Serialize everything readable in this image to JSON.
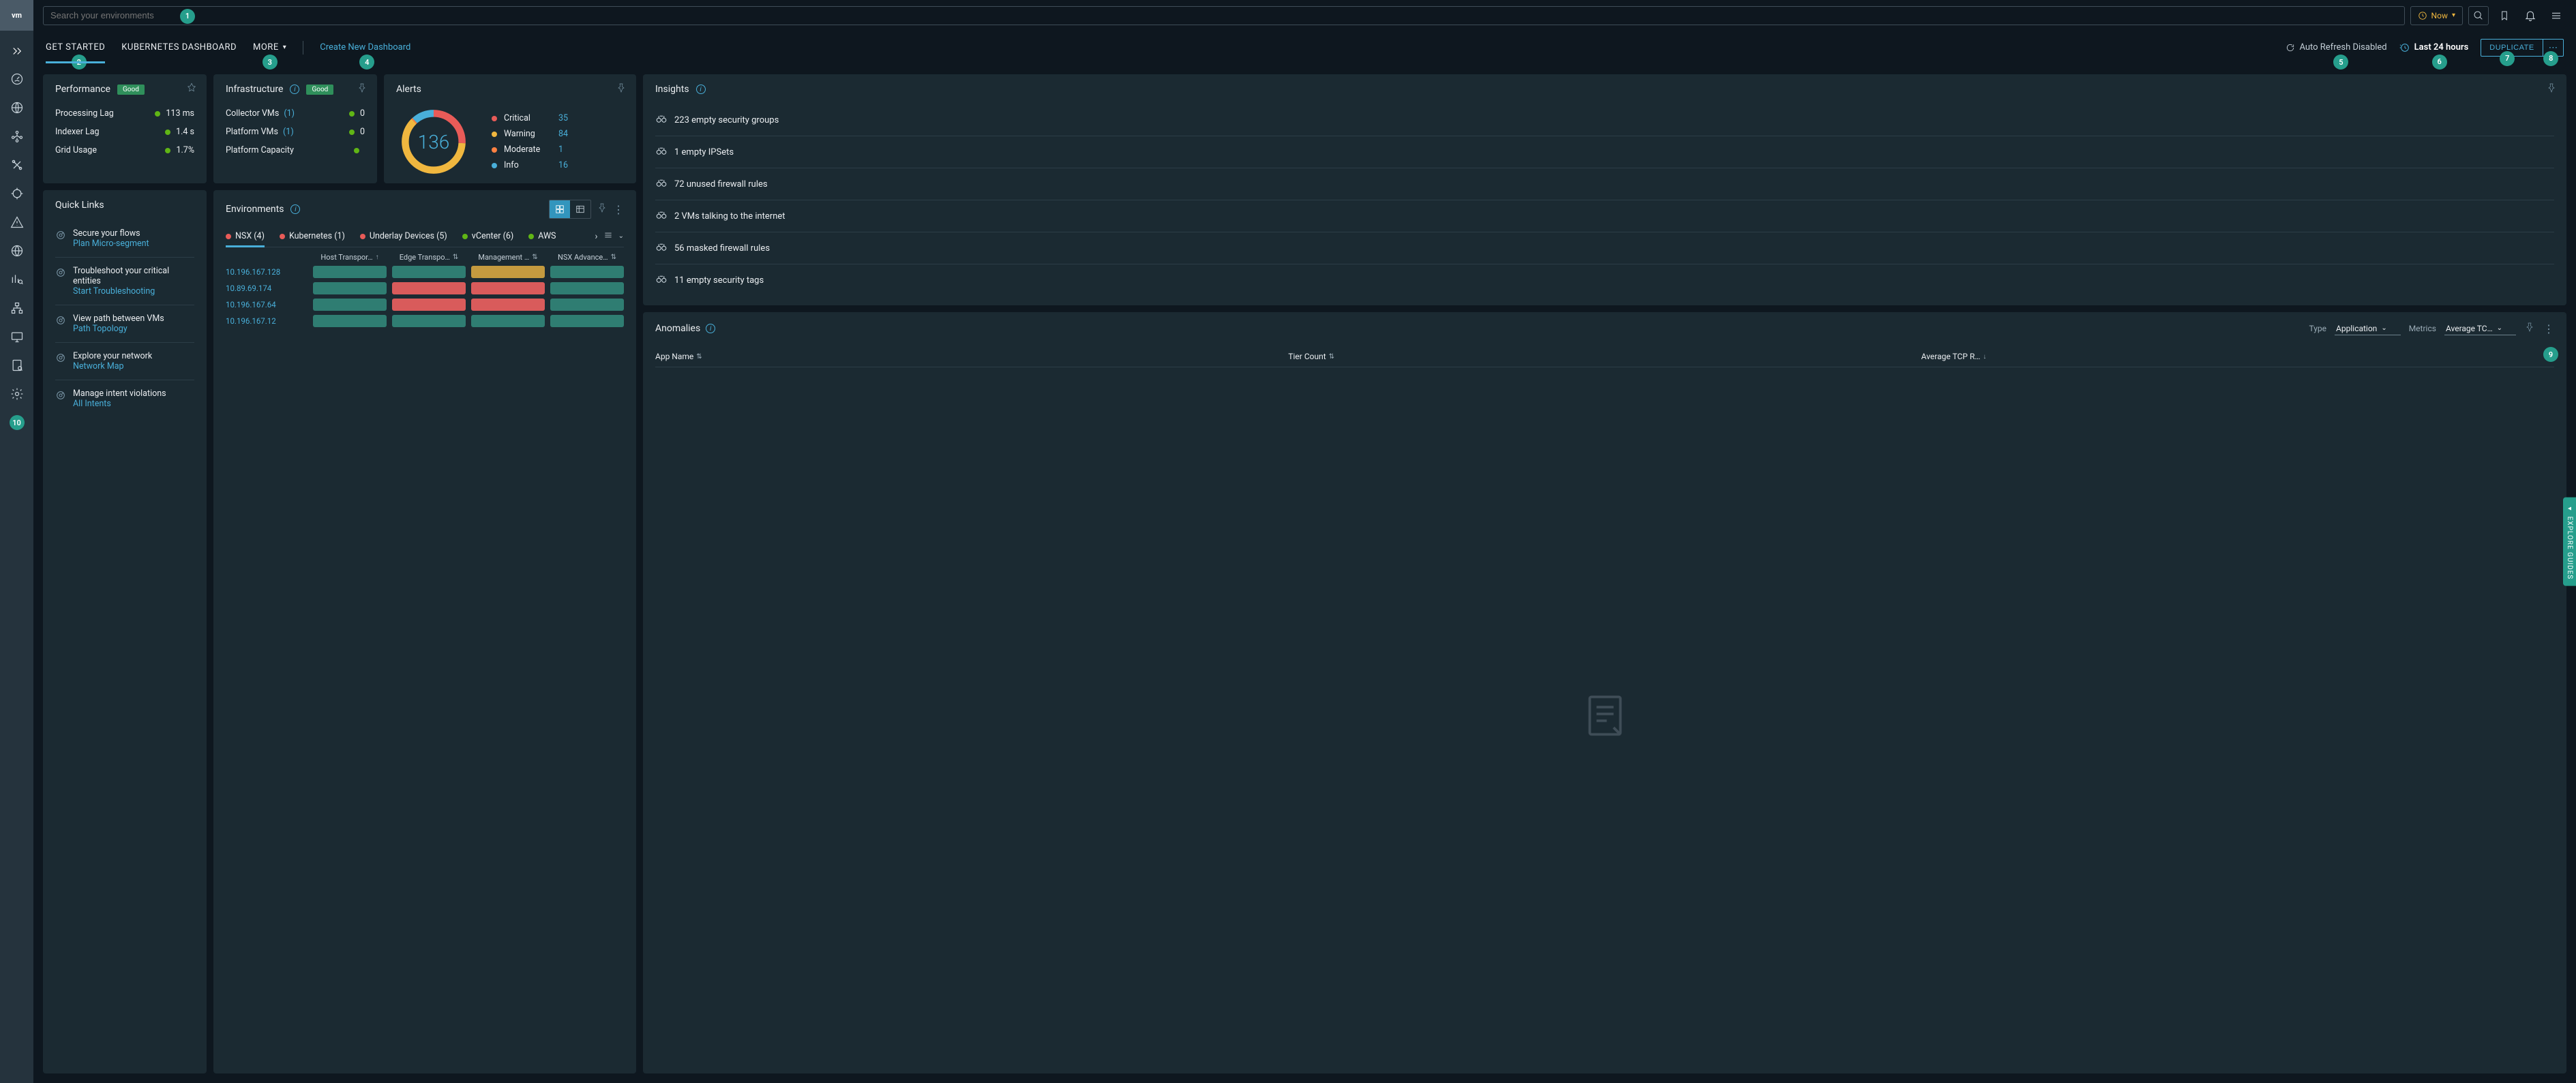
{
  "search": {
    "placeholder": "Search your environments"
  },
  "time_selector": "Now",
  "tabs": {
    "get_started": "GET STARTED",
    "kubernetes": "KUBERNETES DASHBOARD",
    "more": "MORE",
    "create": "Create New Dashboard"
  },
  "toolbar": {
    "auto_refresh": "Auto Refresh Disabled",
    "last_time": "Last 24 hours",
    "duplicate": "DUPLICATE"
  },
  "performance": {
    "title": "Performance",
    "status": "Good",
    "rows": [
      {
        "label": "Processing Lag",
        "value": "113 ms"
      },
      {
        "label": "Indexer Lag",
        "value": "1.4 s"
      },
      {
        "label": "Grid Usage",
        "value": "1.7%"
      }
    ]
  },
  "infrastructure": {
    "title": "Infrastructure",
    "status": "Good",
    "rows": [
      {
        "label": "Collector VMs",
        "count": "(1)",
        "value": "0"
      },
      {
        "label": "Platform VMs",
        "count": "(1)",
        "value": "0"
      },
      {
        "label": "Platform Capacity",
        "count": "",
        "value": ""
      }
    ]
  },
  "alerts": {
    "title": "Alerts",
    "total": "136",
    "items": [
      {
        "label": "Critical",
        "count": "35",
        "color": "red"
      },
      {
        "label": "Warning",
        "count": "84",
        "color": "yellow"
      },
      {
        "label": "Moderate",
        "count": "1",
        "color": "orange"
      },
      {
        "label": "Info",
        "count": "16",
        "color": "blue"
      }
    ]
  },
  "insights": {
    "title": "Insights",
    "items": [
      "223 empty security groups",
      "1 empty IPSets",
      "72 unused firewall rules",
      "2 VMs talking to the internet",
      "56 masked firewall rules",
      "11 empty security tags"
    ]
  },
  "anomalies": {
    "title": "Anomalies",
    "type_label": "Type",
    "type_value": "Application",
    "metrics_label": "Metrics",
    "metrics_value": "Average TC…",
    "columns": [
      "App Name",
      "Tier Count",
      "Average TCP R…"
    ]
  },
  "quicklinks": {
    "title": "Quick Links",
    "items": [
      {
        "t1": "Secure your flows",
        "t2": "Plan Micro-segment"
      },
      {
        "t1": "Troubleshoot your critical entities",
        "t2": "Start Troubleshooting"
      },
      {
        "t1": "View path between VMs",
        "t2": "Path Topology"
      },
      {
        "t1": "Explore your network",
        "t2": "Network Map"
      },
      {
        "t1": "Manage intent violations",
        "t2": "All Intents"
      }
    ]
  },
  "environments": {
    "title": "Environments",
    "tabs": [
      {
        "label": "NSX (4)",
        "color": "red"
      },
      {
        "label": "Kubernetes (1)",
        "color": "red"
      },
      {
        "label": "Underlay Devices (5)",
        "color": "red"
      },
      {
        "label": "vCenter (6)",
        "color": "green"
      },
      {
        "label": "AWS",
        "color": "green"
      }
    ],
    "columns": [
      "Host Transpor…",
      "Edge Transpo…",
      "Management …",
      "NSX Advance…"
    ],
    "rows": [
      {
        "ip": "10.196.167.128",
        "cells": [
          "ok",
          "ok",
          "warn",
          "ok"
        ]
      },
      {
        "ip": "10.89.69.174",
        "cells": [
          "ok",
          "bad",
          "bad",
          "ok"
        ]
      },
      {
        "ip": "10.196.167.64",
        "cells": [
          "ok",
          "bad",
          "bad",
          "ok"
        ]
      },
      {
        "ip": "10.196.167.12",
        "cells": [
          "ok",
          "ok",
          "ok",
          "ok"
        ]
      }
    ]
  },
  "explore_guides": "EXPLORE GUIDES",
  "tour_badges": [
    "1",
    "2",
    "3",
    "4",
    "5",
    "6",
    "7",
    "8",
    "9",
    "10"
  ]
}
